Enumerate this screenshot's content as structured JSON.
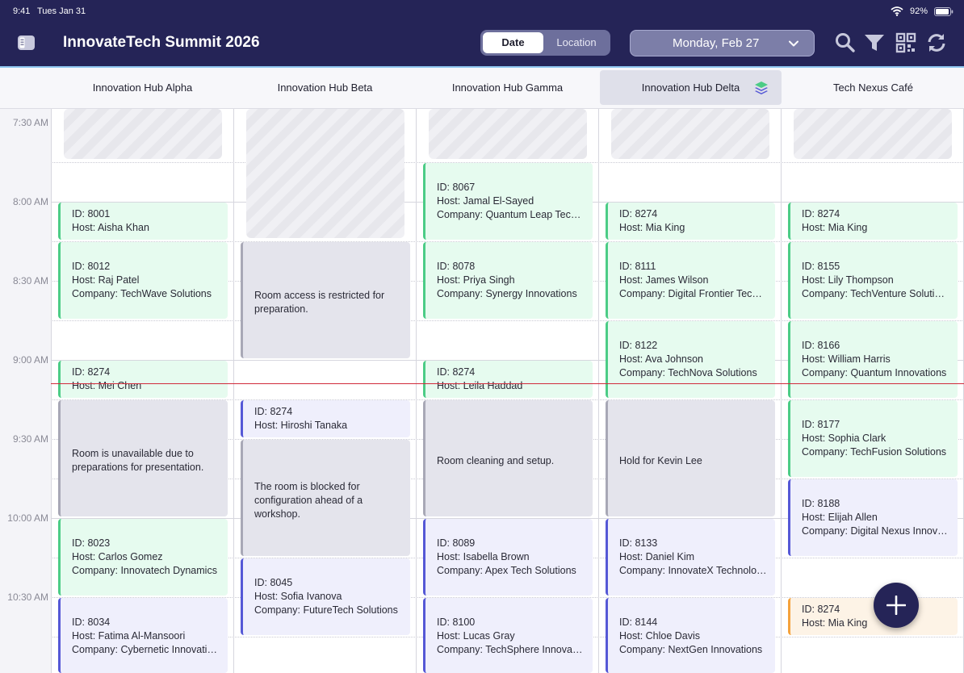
{
  "status_bar": {
    "time": "9:41",
    "date": "Tues Jan 31",
    "battery": "92%"
  },
  "app": {
    "title": "InnovateTech Summit 2026"
  },
  "view_toggle": {
    "date": "Date",
    "location": "Location",
    "selected": "Date"
  },
  "date_picker": {
    "value": "Monday, Feb 27"
  },
  "toolbar_icons": [
    "search-icon",
    "filter-icon",
    "qr-code-icon",
    "refresh-icon"
  ],
  "columns": [
    "Innovation Hub Alpha",
    "Innovation Hub Beta",
    "Innovation Hub Gamma",
    "Innovation Hub Delta",
    "Tech Nexus Café"
  ],
  "selected_column": "Innovation Hub Delta",
  "times": [
    "7:30 AM",
    "8:00 AM",
    "8:30 AM",
    "9:00 AM",
    "9:30 AM",
    "10:00 AM",
    "10:30 AM"
  ],
  "colors": {
    "brand": "#252457",
    "confirmed": "#4ccc86",
    "tentative": "#5558d6",
    "blocked": "#a8a8b6",
    "pending": "#f5a23c",
    "now_line": "#d02a3a"
  },
  "alpha": {
    "e1": {
      "id": "ID: 8001",
      "host": "Host: Aisha Khan"
    },
    "e2": {
      "id": "ID: 8012",
      "host": "Host: Raj Patel",
      "company": "Company: TechWave Solutions"
    },
    "e3": {
      "id": "ID: 8274",
      "host": "Host: Mei Chen"
    },
    "e4": {
      "text": "Room is unavailable due to preparations for presentation."
    },
    "e5": {
      "id": "ID: 8023",
      "host": "Host: Carlos Gomez",
      "company": "Company: Innovatech Dynamics"
    },
    "e6": {
      "id": "ID: 8034",
      "host": "Host: Fatima Al-Mansoori",
      "company": "Company: Cybernetic Innovations"
    }
  },
  "beta": {
    "e1": {
      "text": "Room access is restricted for preparation."
    },
    "e2": {
      "id": "ID: 8274",
      "host": "Host: Hiroshi Tanaka"
    },
    "e3": {
      "text": "The room is blocked for configuration ahead of a workshop."
    },
    "e4": {
      "id": "ID: 8045",
      "host": "Host: Sofia Ivanova",
      "company": "Company: FutureTech Solutions"
    }
  },
  "gamma": {
    "e1": {
      "id": "ID: 8067",
      "host": "Host: Jamal El-Sayed",
      "company": "Company: Quantum Leap Technologies"
    },
    "e2": {
      "id": "ID: 8078",
      "host": "Host: Priya Singh",
      "company": "Company: Synergy Innovations"
    },
    "e3": {
      "id": "ID: 8274",
      "host": "Host: Leila Haddad"
    },
    "e4": {
      "text": "Room cleaning and setup."
    },
    "e5": {
      "id": "ID: 8089",
      "host": "Host: Isabella Brown",
      "company": "Company: Apex Tech Solutions"
    },
    "e6": {
      "id": "ID: 8100",
      "host": "Host: Lucas Gray",
      "company": "Company: TechSphere Innovations"
    }
  },
  "delta": {
    "e1": {
      "id": "ID: 8274",
      "host": "Host: Mia King"
    },
    "e2": {
      "id": "ID: 8111",
      "host": "Host: James Wilson",
      "company": "Company: Digital Frontier Technologies"
    },
    "e3": {
      "id": "ID: 8122",
      "host": "Host: Ava Johnson",
      "company": "Company: TechNova Solutions"
    },
    "e4": {
      "text": "Hold for Kevin Lee"
    },
    "e5": {
      "id": "ID: 8133",
      "host": "Host: Daniel Kim",
      "company": "Company: InnovateX Technologies"
    },
    "e6": {
      "id": "ID: 8144",
      "host": "Host: Chloe Davis",
      "company": "Company: NextGen Innovations"
    }
  },
  "nexus": {
    "e1": {
      "id": "ID: 8274",
      "host": "Host: Mia King"
    },
    "e2": {
      "id": "ID: 8155",
      "host": "Host: Lily Thompson",
      "company": "Company: TechVenture Solutions"
    },
    "e3": {
      "id": "ID: 8166",
      "host": "Host: William Harris",
      "company": "Company: Quantum Innovations"
    },
    "e4": {
      "id": "ID: 8177",
      "host": "Host: Sophia Clark",
      "company": "Company: TechFusion Solutions"
    },
    "e5": {
      "id": "ID: 8188",
      "host": "Host: Elijah Allen",
      "company": "Company: Digital Nexus Innovations"
    },
    "e6": {
      "id": "ID: 8274",
      "host": "Host: Mia King"
    }
  }
}
